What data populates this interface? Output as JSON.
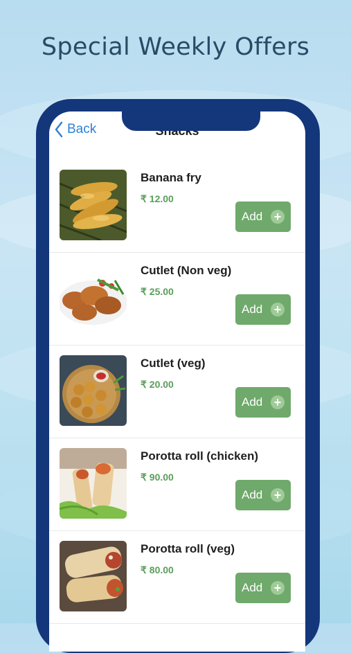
{
  "headline": "Special Weekly Offers",
  "nav": {
    "back_label": "Back",
    "title": "Snacks"
  },
  "items": [
    {
      "name": "Banana fry",
      "price": "₹ 12.00",
      "add_label": "Add",
      "plus": "+"
    },
    {
      "name": "Cutlet (Non veg)",
      "price": "₹ 25.00",
      "add_label": "Add",
      "plus": "+"
    },
    {
      "name": "Cutlet (veg)",
      "price": "₹ 20.00",
      "add_label": "Add",
      "plus": "+"
    },
    {
      "name": "Porotta roll (chicken)",
      "price": "₹ 90.00",
      "add_label": "Add",
      "plus": "+"
    },
    {
      "name": "Porotta roll (veg)",
      "price": "₹ 80.00",
      "add_label": "Add",
      "plus": "+"
    }
  ],
  "colors": {
    "accent": "#6fa96b",
    "price": "#5a9e5a",
    "phone": "#14377b",
    "link": "#2f80d6"
  }
}
